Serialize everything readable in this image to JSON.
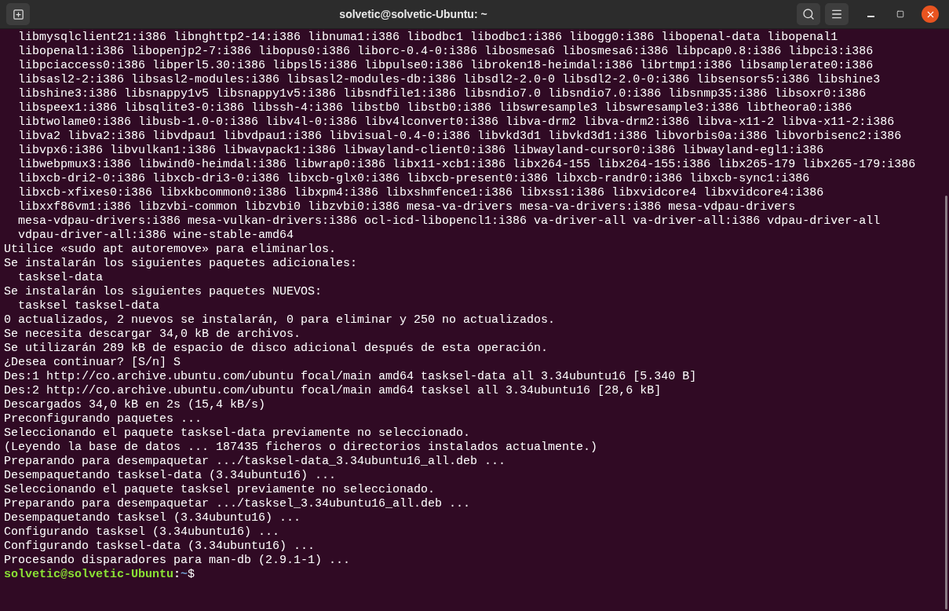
{
  "window": {
    "title": "solvetic@solvetic-Ubuntu: ~"
  },
  "terminal": {
    "lines": [
      "  libmysqlclient21:i386 libnghttp2-14:i386 libnuma1:i386 libodbc1 libodbc1:i386 libogg0:i386 libopenal-data libopenal1",
      "  libopenal1:i386 libopenjp2-7:i386 libopus0:i386 liborc-0.4-0:i386 libosmesa6 libosmesa6:i386 libpcap0.8:i386 libpci3:i386",
      "  libpciaccess0:i386 libperl5.30:i386 libpsl5:i386 libpulse0:i386 libroken18-heimdal:i386 librtmp1:i386 libsamplerate0:i386",
      "  libsasl2-2:i386 libsasl2-modules:i386 libsasl2-modules-db:i386 libsdl2-2.0-0 libsdl2-2.0-0:i386 libsensors5:i386 libshine3",
      "  libshine3:i386 libsnappy1v5 libsnappy1v5:i386 libsndfile1:i386 libsndio7.0 libsndio7.0:i386 libsnmp35:i386 libsoxr0:i386",
      "  libspeex1:i386 libsqlite3-0:i386 libssh-4:i386 libstb0 libstb0:i386 libswresample3 libswresample3:i386 libtheora0:i386",
      "  libtwolame0:i386 libusb-1.0-0:i386 libv4l-0:i386 libv4lconvert0:i386 libva-drm2 libva-drm2:i386 libva-x11-2 libva-x11-2:i386",
      "  libva2 libva2:i386 libvdpau1 libvdpau1:i386 libvisual-0.4-0:i386 libvkd3d1 libvkd3d1:i386 libvorbis0a:i386 libvorbisenc2:i386",
      "  libvpx6:i386 libvulkan1:i386 libwavpack1:i386 libwayland-client0:i386 libwayland-cursor0:i386 libwayland-egl1:i386",
      "  libwebpmux3:i386 libwind0-heimdal:i386 libwrap0:i386 libx11-xcb1:i386 libx264-155 libx264-155:i386 libx265-179 libx265-179:i386",
      "  libxcb-dri2-0:i386 libxcb-dri3-0:i386 libxcb-glx0:i386 libxcb-present0:i386 libxcb-randr0:i386 libxcb-sync1:i386",
      "  libxcb-xfixes0:i386 libxkbcommon0:i386 libxpm4:i386 libxshmfence1:i386 libxss1:i386 libxvidcore4 libxvidcore4:i386",
      "  libxxf86vm1:i386 libzvbi-common libzvbi0 libzvbi0:i386 mesa-va-drivers mesa-va-drivers:i386 mesa-vdpau-drivers",
      "  mesa-vdpau-drivers:i386 mesa-vulkan-drivers:i386 ocl-icd-libopencl1:i386 va-driver-all va-driver-all:i386 vdpau-driver-all",
      "  vdpau-driver-all:i386 wine-stable-amd64",
      "Utilice «sudo apt autoremove» para eliminarlos.",
      "Se instalarán los siguientes paquetes adicionales:",
      "  tasksel-data",
      "Se instalarán los siguientes paquetes NUEVOS:",
      "  tasksel tasksel-data",
      "0 actualizados, 2 nuevos se instalarán, 0 para eliminar y 250 no actualizados.",
      "Se necesita descargar 34,0 kB de archivos.",
      "Se utilizarán 289 kB de espacio de disco adicional después de esta operación.",
      "¿Desea continuar? [S/n] S",
      "Des:1 http://co.archive.ubuntu.com/ubuntu focal/main amd64 tasksel-data all 3.34ubuntu16 [5.340 B]",
      "Des:2 http://co.archive.ubuntu.com/ubuntu focal/main amd64 tasksel all 3.34ubuntu16 [28,6 kB]",
      "Descargados 34,0 kB en 2s (15,4 kB/s)",
      "Preconfigurando paquetes ...",
      "Seleccionando el paquete tasksel-data previamente no seleccionado.",
      "(Leyendo la base de datos ... 187435 ficheros o directorios instalados actualmente.)",
      "Preparando para desempaquetar .../tasksel-data_3.34ubuntu16_all.deb ...",
      "Desempaquetando tasksel-data (3.34ubuntu16) ...",
      "Seleccionando el paquete tasksel previamente no seleccionado.",
      "Preparando para desempaquetar .../tasksel_3.34ubuntu16_all.deb ...",
      "Desempaquetando tasksel (3.34ubuntu16) ...",
      "Configurando tasksel (3.34ubuntu16) ...",
      "Configurando tasksel-data (3.34ubuntu16) ...",
      "Procesando disparadores para man-db (2.9.1-1) ..."
    ],
    "prompt": {
      "user": "solvetic@solvetic-Ubuntu",
      "separator": ":",
      "path": "~",
      "symbol": "$"
    }
  }
}
